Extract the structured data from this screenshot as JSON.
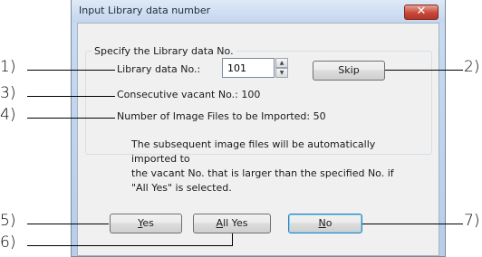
{
  "dialog": {
    "title": "Input Library data number",
    "close_label": "✕",
    "group_label": "Specify the Library data No.",
    "library_no_label": "Library data No.:",
    "library_no_value": "101",
    "spin_up": "▲",
    "spin_down": "▼",
    "skip_label": "Skip",
    "consecutive_label": "Consecutive vacant No.: 100",
    "import_count_label": "Number of Image Files to be Imported: 50",
    "info_lines": [
      "The subsequent image files will be automatically imported to",
      "the vacant No. that is larger than the specified No. if",
      "\"All Yes\" is selected."
    ],
    "yes_mnemonic": "Y",
    "yes_rest": "es",
    "allyes_mnemonic": "A",
    "allyes_rest": "ll Yes",
    "no_mnemonic": "N",
    "no_rest": "o"
  },
  "callouts": {
    "c1": "1)",
    "c2": "2)",
    "c3": "3)",
    "c4": "4)",
    "c5": "5)",
    "c6": "6)",
    "c7": "7)"
  }
}
